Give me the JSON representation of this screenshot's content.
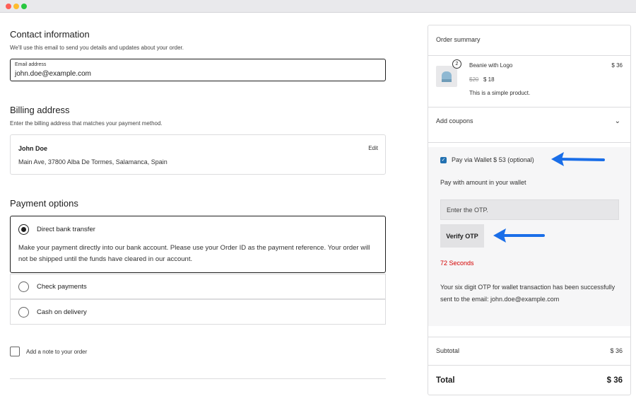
{
  "contact": {
    "heading": "Contact information",
    "subtext": "We'll use this email to send you details and updates about your order.",
    "email_label": "Email address",
    "email_value": "john.doe@example.com"
  },
  "billing": {
    "heading": "Billing address",
    "subtext": "Enter the billing address that matches your payment method.",
    "name": "John Doe",
    "address": "Main Ave, 37800 Alba De Tormes, Salamanca, Spain",
    "edit_label": "Edit"
  },
  "payment": {
    "heading": "Payment options",
    "options": [
      {
        "label": "Direct bank transfer",
        "selected": true
      },
      {
        "label": "Check payments",
        "selected": false
      },
      {
        "label": "Cash on delivery",
        "selected": false
      }
    ],
    "description": "Make your payment directly into our bank account. Please use your Order ID as the payment reference. Your order will not be shipped until the funds have cleared in our account."
  },
  "note": {
    "label": "Add a note to your order",
    "checked": false
  },
  "summary": {
    "title": "Order summary",
    "product": {
      "quantity": "2",
      "name": "Beanie with Logo",
      "line_total": "$ 36",
      "regular_price": "$20",
      "sale_price": "$ 18",
      "description": "This is a simple product."
    },
    "coupons_label": "Add coupons",
    "wallet": {
      "checkbox_label": "Pay via Wallet $ 53 (optional)",
      "checked": true,
      "subtext": "Pay with amount in your wallet",
      "otp_placeholder": "Enter the OTP.",
      "verify_label": "Verify OTP",
      "timer": "72 Seconds",
      "message": "Your six digit OTP for wallet transaction has been successfully sent to the email: john.doe@example.com"
    },
    "subtotal_label": "Subtotal",
    "subtotal_value": "$ 36",
    "total_label": "Total",
    "total_value": "$ 36"
  },
  "colors": {
    "accent": "#2271b1",
    "arrow": "#1a6ee8",
    "timer": "#d40000"
  }
}
